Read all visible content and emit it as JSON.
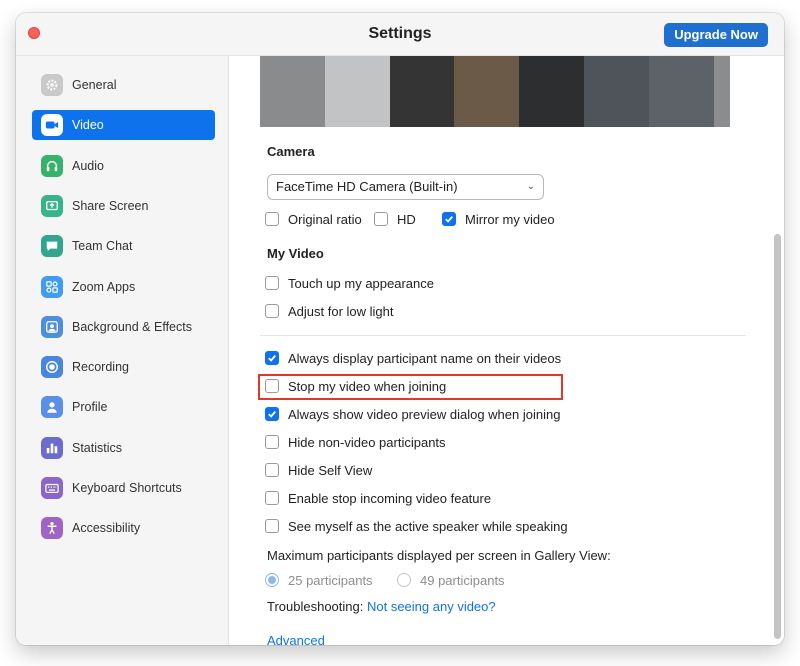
{
  "window": {
    "title": "Settings",
    "upgrade_label": "Upgrade Now"
  },
  "sidebar": {
    "active_index": 1,
    "items": [
      {
        "label": "General",
        "icon": "gear-icon",
        "color": "#c9c9c9"
      },
      {
        "label": "Video",
        "icon": "video-camera-icon",
        "color": "#ffffff"
      },
      {
        "label": "Audio",
        "icon": "headphones-icon",
        "color": "#35b36a"
      },
      {
        "label": "Share Screen",
        "icon": "share-screen-icon",
        "color": "#38b48b"
      },
      {
        "label": "Team Chat",
        "icon": "chat-bubble-icon",
        "color": "#31a58d"
      },
      {
        "label": "Zoom Apps",
        "icon": "apps-icon",
        "color": "#3f9cf2"
      },
      {
        "label": "Background & Effects",
        "icon": "background-icon",
        "color": "#4f8fd9"
      },
      {
        "label": "Recording",
        "icon": "record-icon",
        "color": "#4a86e0"
      },
      {
        "label": "Profile",
        "icon": "person-icon",
        "color": "#5b8ee6"
      },
      {
        "label": "Statistics",
        "icon": "bar-chart-icon",
        "color": "#6c6ccf"
      },
      {
        "label": "Keyboard Shortcuts",
        "icon": "keyboard-icon",
        "color": "#8b66c9"
      },
      {
        "label": "Accessibility",
        "icon": "accessibility-icon",
        "color": "#a065c4"
      }
    ]
  },
  "preview_tiles": [
    "#8a8b8d",
    "#c2c3c5",
    "#343434",
    "#6b5a48",
    "#2d2e30",
    "#4f535a",
    "#5c6268",
    "#8a8c8e"
  ],
  "camera": {
    "heading": "Camera",
    "selected_camera": "FaceTime HD Camera (Built-in)",
    "options": [
      {
        "label": "Original ratio",
        "checked": false
      },
      {
        "label": "HD",
        "checked": false
      },
      {
        "label": "Mirror my video",
        "checked": true
      }
    ]
  },
  "my_video": {
    "heading": "My Video",
    "options": [
      {
        "label": "Touch up my appearance",
        "checked": false
      },
      {
        "label": "Adjust for low light",
        "checked": false
      }
    ]
  },
  "general_options": [
    {
      "label": "Always display participant name on their videos",
      "checked": true
    },
    {
      "label": "Stop my video when joining",
      "checked": false
    },
    {
      "label": "Always show video preview dialog when joining",
      "checked": true
    },
    {
      "label": "Hide non-video participants",
      "checked": false
    },
    {
      "label": "Hide Self View",
      "checked": false
    },
    {
      "label": "Enable stop incoming video feature",
      "checked": false
    },
    {
      "label": "See myself as the active speaker while speaking",
      "checked": false
    }
  ],
  "gallery": {
    "label": "Maximum participants displayed per screen in Gallery View:",
    "options": [
      {
        "label": "25 participants",
        "selected": true
      },
      {
        "label": "49 participants",
        "selected": false
      }
    ]
  },
  "troubleshooting": {
    "label": "Troubleshooting:",
    "link": "Not seeing any video?"
  },
  "advanced_label": "Advanced",
  "colors": {
    "accent": "#0e72ed",
    "highlight_box": "#e0392a",
    "close_button": "#fe5f57"
  }
}
